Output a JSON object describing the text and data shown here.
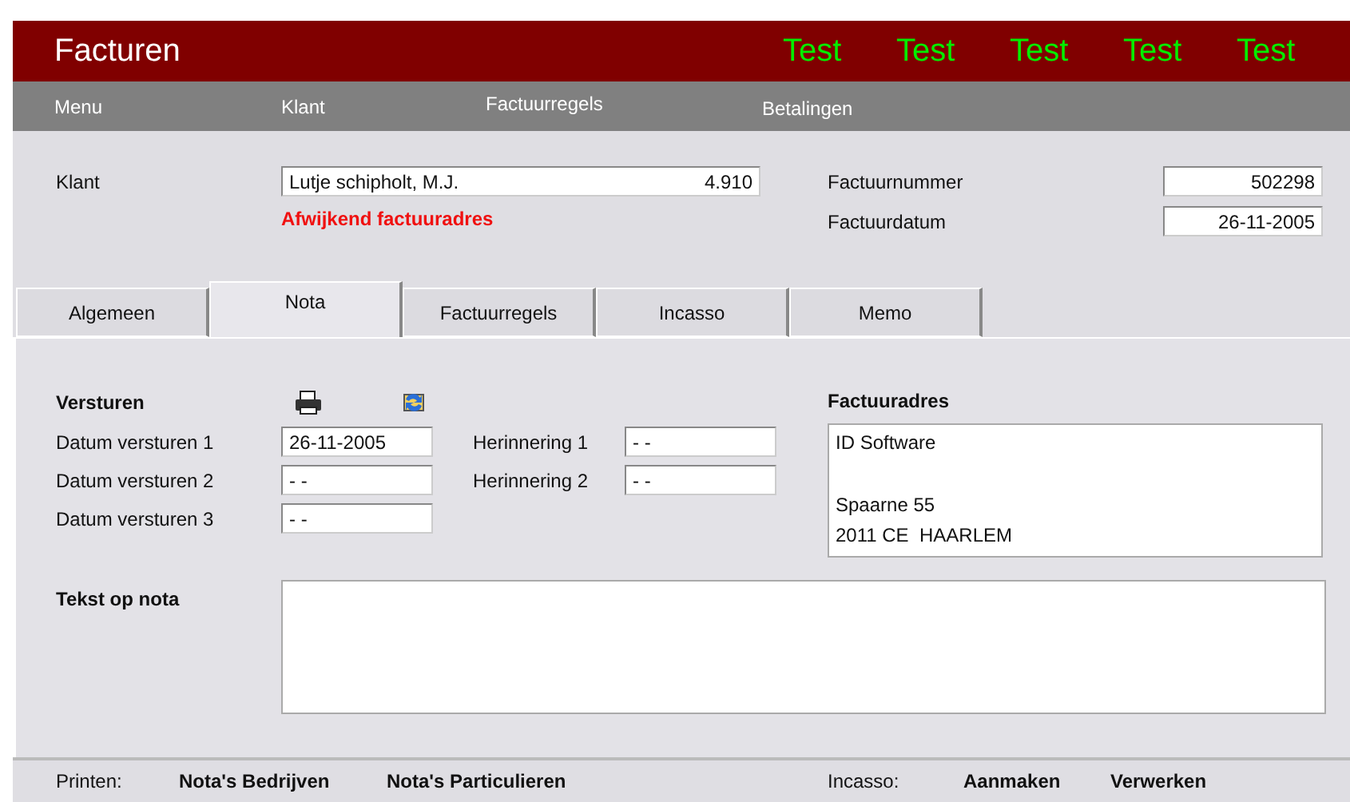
{
  "header": {
    "title": "Facturen",
    "badges": [
      "Test",
      "Test",
      "Test",
      "Test",
      "Test"
    ]
  },
  "menu": [
    "Menu",
    "Klant",
    "Factuurregels",
    "Betalingen"
  ],
  "customer": {
    "label": "Klant",
    "name": "Lutje schipholt, M.J.",
    "number": "4.910",
    "alt_address_link": "Afwijkend factuuradres"
  },
  "invoice": [
    {
      "label": "Factuurnummer",
      "value": "502298"
    },
    {
      "label": "Factuurdatum",
      "value": "26-11-2005"
    }
  ],
  "tabs": [
    {
      "label": "Algemeen",
      "selected": false
    },
    {
      "label": "Nota",
      "selected": true
    },
    {
      "label": "Factuurregels",
      "selected": false
    },
    {
      "label": "Incasso",
      "selected": false
    },
    {
      "label": "Memo",
      "selected": false
    }
  ],
  "send": {
    "heading": "Versturen",
    "dates": [
      {
        "label": "Datum versturen 1",
        "value": "26-11-2005"
      },
      {
        "label": "Datum versturen 2",
        "value": "- -"
      },
      {
        "label": "Datum versturen 3",
        "value": "- -"
      }
    ],
    "reminders": [
      {
        "label": "Herinnering 1",
        "value": "- -"
      },
      {
        "label": "Herinnering 2",
        "value": "- -"
      }
    ]
  },
  "address": {
    "heading": "Factuuradres",
    "lines": [
      {
        "text": "ID Software",
        "blank_line_before": false
      },
      {
        "text": "Spaarne 55",
        "blank_line_before": true
      },
      {
        "text": "2011 CE  HAARLEM",
        "blank_line_before": false
      }
    ]
  },
  "note": {
    "label": "Tekst op nota"
  },
  "footer": {
    "print_label": "Printen:",
    "print_links": [
      "Nota's Bedrijven",
      "Nota's Particulieren"
    ],
    "incasso_label": "Incasso:",
    "incasso_links": [
      "Aanmaken",
      "Verwerken"
    ]
  }
}
